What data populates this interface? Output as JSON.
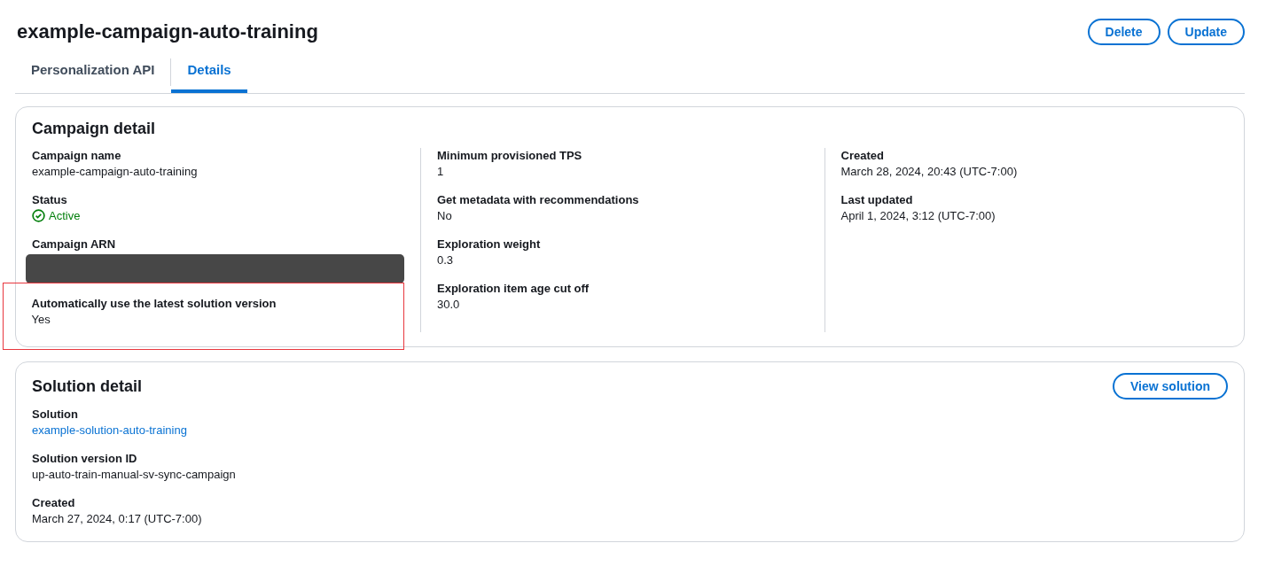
{
  "title": "example-campaign-auto-training",
  "actions": [
    "Delete",
    "Update"
  ],
  "tabs": [
    {
      "label": "Personalization API",
      "selected": false
    },
    {
      "label": "Details",
      "selected": true
    }
  ],
  "campaign_detail": {
    "heading": "Campaign detail",
    "columns": [
      [
        {
          "label": "Campaign name",
          "kind": "text",
          "value": "example-campaign-auto-training",
          "highlighted": false
        },
        {
          "label": "Status",
          "kind": "status",
          "value": "Active",
          "highlighted": false
        },
        {
          "label": "Campaign ARN",
          "kind": "redacted",
          "highlighted": false
        },
        {
          "label": "Automatically use the latest solution version",
          "kind": "text",
          "value": "Yes",
          "highlighted": true
        }
      ],
      [
        {
          "label": "Minimum provisioned TPS",
          "kind": "text",
          "value": "1",
          "highlighted": false
        },
        {
          "label": "Get metadata with recommendations",
          "kind": "text",
          "value": "No",
          "highlighted": false
        },
        {
          "label": "Exploration weight",
          "kind": "text",
          "value": "0.3",
          "highlighted": false
        },
        {
          "label": "Exploration item age cut off",
          "kind": "text",
          "value": "30.0",
          "highlighted": false
        }
      ],
      [
        {
          "label": "Created",
          "kind": "text",
          "value": "March 28, 2024, 20:43 (UTC-7:00)",
          "highlighted": false
        },
        {
          "label": "Last updated",
          "kind": "text",
          "value": "April 1, 2024, 3:12 (UTC-7:00)",
          "highlighted": false
        }
      ]
    ]
  },
  "solution_detail": {
    "heading": "Solution detail",
    "button": "View solution",
    "fields": [
      {
        "label": "Solution",
        "kind": "link",
        "value": "example-solution-auto-training",
        "highlighted": false
      },
      {
        "label": "Solution version ID",
        "kind": "text",
        "value": "up-auto-train-manual-sv-sync-campaign",
        "highlighted": false
      },
      {
        "label": "Created",
        "kind": "text",
        "value": "March 27, 2024, 0:17 (UTC-7:00)",
        "highlighted": false
      }
    ]
  }
}
